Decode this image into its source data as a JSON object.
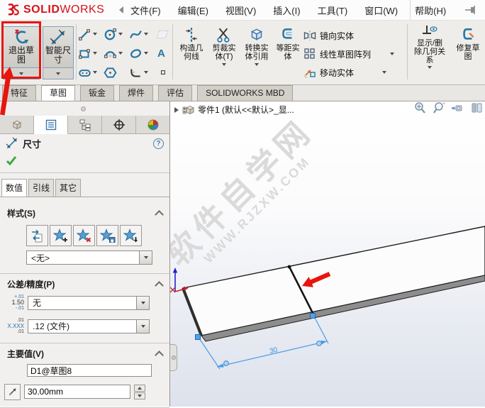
{
  "title_bar": {
    "brand_bold": "SOLID",
    "brand_light": "WORKS",
    "menus": [
      "文件(F)",
      "编辑(E)",
      "视图(V)",
      "插入(I)",
      "工具(T)",
      "窗口(W)",
      "帮助(H)"
    ]
  },
  "ribbon": {
    "exit_sketch": "退出草图",
    "smart_dimension": "智能尺寸",
    "construction_geometry": "构造几何线",
    "trim_entities": "剪裁实体(T)",
    "convert_entities": "转换实体引用",
    "offset_entities": "等距实体",
    "mirror_entities": "镜向实体",
    "linear_pattern": "线性草图阵列",
    "move_entities": "移动实体",
    "display_delete_relations": "显示/删除几何关系",
    "repair_sketch": "修复草图",
    "text_tool_glyph": "A"
  },
  "command_tabs": {
    "items": [
      "特征",
      "草图",
      "钣金",
      "焊件",
      "评估",
      "SOLIDWORKS MBD"
    ],
    "active": "草图"
  },
  "feature_tree": {
    "root": "零件1  (默认<<默认>_显..."
  },
  "property_manager": {
    "title": "尺寸",
    "help_glyph": "?",
    "tabs": [
      "数值",
      "引线",
      "其它"
    ],
    "style": {
      "label": "样式(S)",
      "value": "<无>"
    },
    "tolerance": {
      "label": "公差/精度(P)",
      "tolerance_value": "无",
      "precision_value": ".12 (文件)",
      "tol_icon_top": "+.01",
      "tol_icon_mid": "1.50",
      "tol_icon_bot": "-.01",
      "prec_icon_top": ".01",
      "prec_icon_mid": "X.XXX",
      "prec_icon_bot": ".01"
    },
    "primary_value": {
      "label": "主要值(V)",
      "name": "D1@草图8",
      "value": "30.00mm"
    }
  },
  "viewport": {
    "dimension_label": "30",
    "watermark_line1": "软件自学网",
    "watermark_line2": "WWW.RJZXW.COM"
  },
  "colors": {
    "annotation_red": "#e8150d",
    "dimension_blue": "#4a9ce8",
    "brand_red": "#d6121b",
    "tool_blue": "#2677a5"
  }
}
